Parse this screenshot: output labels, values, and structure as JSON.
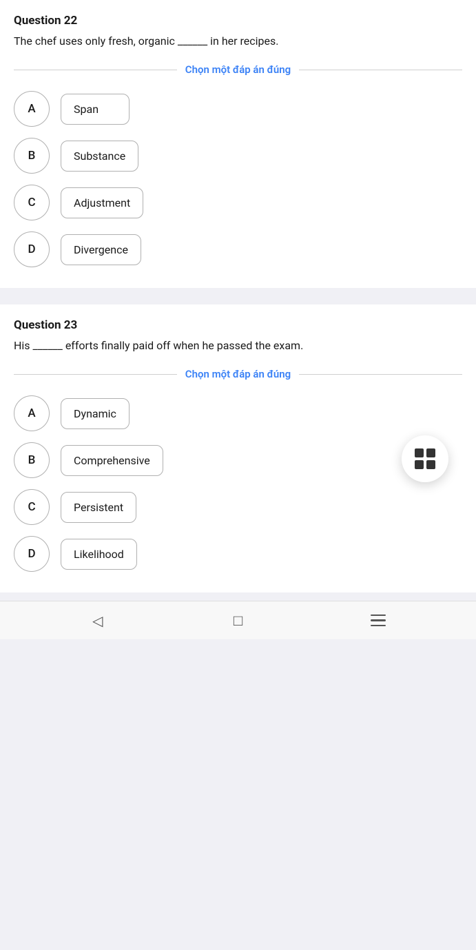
{
  "question22": {
    "number": "Question 22",
    "text": "The chef uses only fresh, organic ______ in her recipes.",
    "divider_label": "Chọn một đáp án đúng",
    "options": [
      {
        "letter": "A",
        "text": "Span"
      },
      {
        "letter": "B",
        "text": "Substance"
      },
      {
        "letter": "C",
        "text": "Adjustment"
      },
      {
        "letter": "D",
        "text": "Divergence"
      }
    ]
  },
  "question23": {
    "number": "Question 23",
    "text": "His ______ efforts finally paid off when he passed the exam.",
    "divider_label": "Chọn một đáp án đúng",
    "options": [
      {
        "letter": "A",
        "text": "Dynamic"
      },
      {
        "letter": "B",
        "text": "Comprehensive"
      },
      {
        "letter": "C",
        "text": "Persistent"
      },
      {
        "letter": "D",
        "text": "Likelihood"
      }
    ]
  },
  "nav": {
    "back": "back",
    "home": "home",
    "menu": "menu"
  }
}
